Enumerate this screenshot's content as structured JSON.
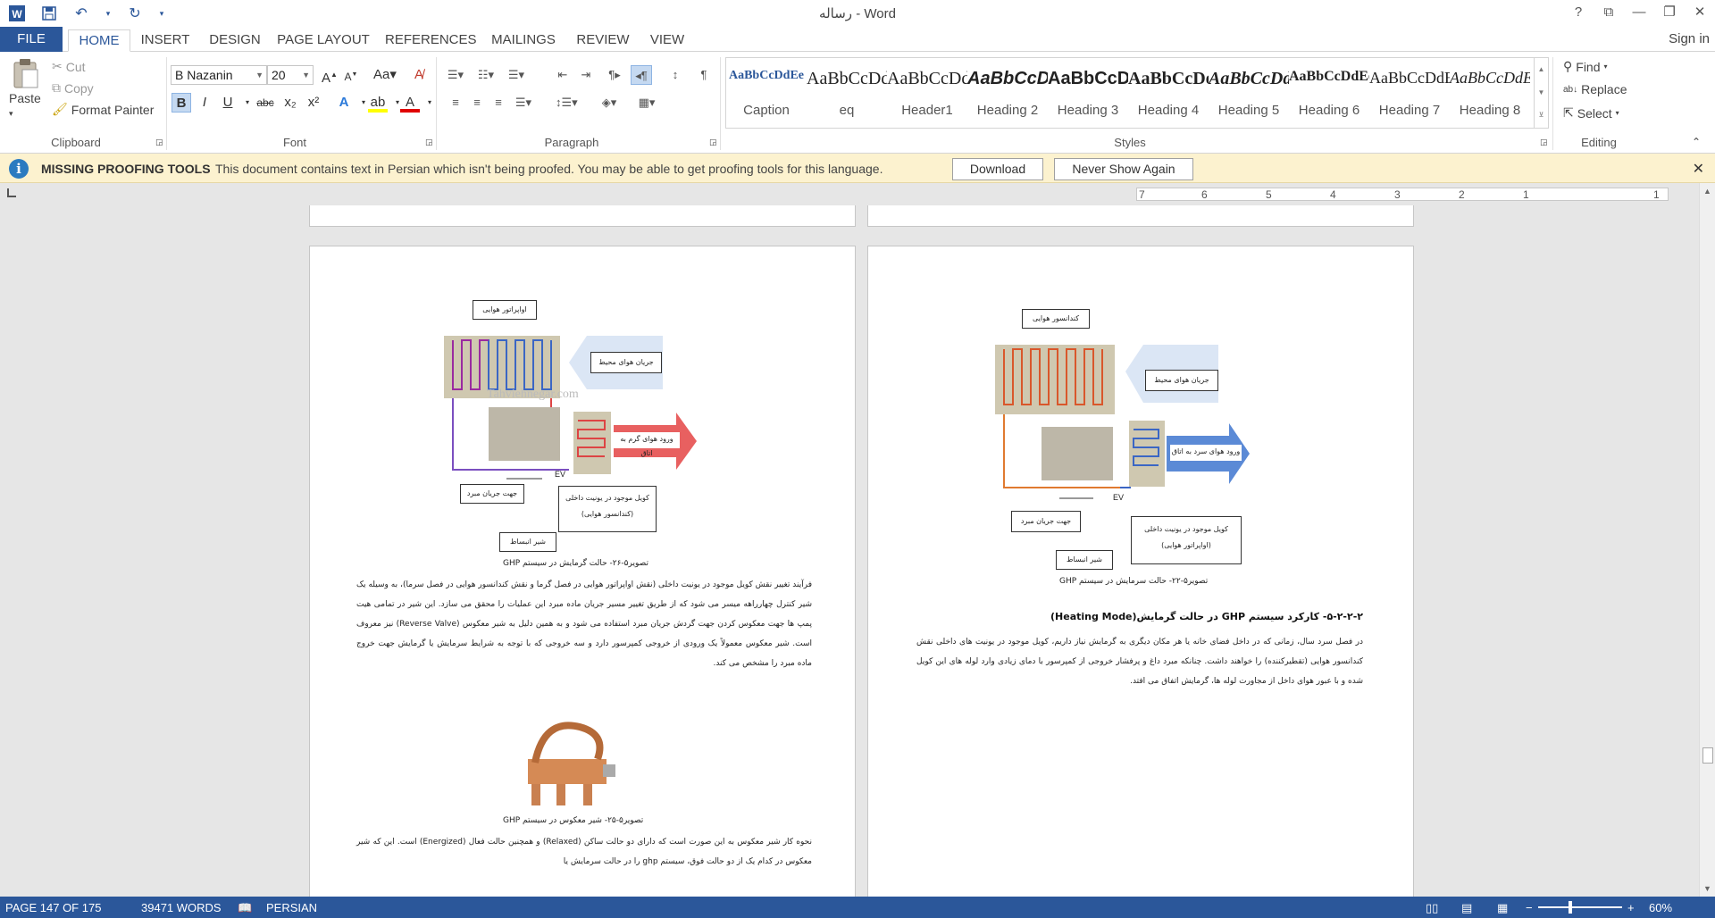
{
  "window": {
    "title": "رساله - Word"
  },
  "tabs": {
    "file": "FILE",
    "home": "HOME",
    "insert": "INSERT",
    "design": "DESIGN",
    "page_layout": "PAGE LAYOUT",
    "references": "REFERENCES",
    "mailings": "MAILINGS",
    "review": "REVIEW",
    "view": "VIEW",
    "sign_in": "Sign in"
  },
  "clipboard": {
    "paste": "Paste",
    "cut": "Cut",
    "copy": "Copy",
    "format_painter": "Format Painter",
    "label": "Clipboard"
  },
  "font": {
    "name": "B Nazanin",
    "size": "20",
    "label": "Font",
    "bold": "B",
    "italic": "I",
    "underline": "U",
    "strike": "abc",
    "subscript": "x₂",
    "superscript": "x²"
  },
  "paragraph": {
    "label": "Paragraph"
  },
  "styles": {
    "label": "Styles",
    "items": [
      {
        "sample": "AaBbCcDdEe",
        "name": "Caption"
      },
      {
        "sample": "AaBbCcDdEe",
        "name": "eq"
      },
      {
        "sample": "AaBbCcDdEe",
        "name": "Header1"
      },
      {
        "sample": "AaBbCcDdEe",
        "name": "Heading 2"
      },
      {
        "sample": "AaBbCcDdEe",
        "name": "Heading 3"
      },
      {
        "sample": "AaBbCcDdEe",
        "name": "Heading 4"
      },
      {
        "sample": "AaBbCcDdEe",
        "name": "Heading 5"
      },
      {
        "sample": "AaBbCcDdEe",
        "name": "Heading 6"
      },
      {
        "sample": "AaBbCcDdEe",
        "name": "Heading 7"
      },
      {
        "sample": "AaBbCcDdEe",
        "name": "Heading 8"
      }
    ]
  },
  "editing": {
    "find": "Find",
    "replace": "Replace",
    "select": "Select",
    "label": "Editing"
  },
  "message_bar": {
    "title": "MISSING PROOFING TOOLS",
    "text": "This document contains text in Persian which isn't being proofed. You may be able to get proofing tools for this language.",
    "download": "Download",
    "never_show": "Never Show Again"
  },
  "ruler": {
    "ticks": [
      "7",
      "6",
      "5",
      "4",
      "3",
      "2",
      "1",
      "1"
    ]
  },
  "left_page": {
    "fig1_labels": {
      "evaporator": "اواپراتور هوایی",
      "ambient": "جریان هوای محیط",
      "warm_air": "ورود هوای گرم به اتاق",
      "flow_dir": "جهت جریان مبرد",
      "expansion": "شیر انبساط",
      "indoor_coil": "کویل موجود در یونیت داخلی",
      "condenser_air": "(کندانسور هوایی)",
      "ev": "EV",
      "watermark": "Tahviehnegar.com"
    },
    "fig1_caption": "تصویر۵-۲۶- حالت گرمایش در سیستم GHP",
    "para1": "فرآیند تغییر نقش کویل موجود در یونیت داخلی (نقش اواپراتور هوایی در فصل گرما و نقش کندانسور هوایی در فصل سرما)، به وسیله یک شیر کنترل چهارراهه میسر می شود که از طریق تغییر مسیر جریان ماده مبرد این عملیات را محقق می سازد. این شیر در تمامی هیت پمپ ها جهت معکوس کردن جهت گردش جریان مبرد استفاده می شود و به همین دلیل به شیر معکوس (Reverse Valve) نیز معروف است. شیر معکوس معمولاً یک ورودی از خروجی کمپرسور دارد و سه خروجی که با توجه به شرایط سرمایش یا گرمایش جهت خروج ماده مبرد را مشخص می کند.",
    "fig2_caption": "تصویر۵-۲۵- شیر معکوس در سیستم GHP",
    "para2": "نحوه کار شیر معکوس به این صورت است که دارای دو حالت ساکن (Relaxed) و همچنین حالت فعال (Energized) است. این که شیر معکوس در کدام یک از دو حالت فوق، سیستم ghp را در حالت سرمایش یا"
  },
  "right_page": {
    "fig1_labels": {
      "condenser": "کندانسور هوایی",
      "ambient": "جریان هوای محیط",
      "cool_air": "ورود هوای سرد به اتاق",
      "flow_dir": "جهت جریان مبرد",
      "expansion": "شیر انبساط",
      "indoor_coil": "کویل موجود در یونیت داخلی",
      "evap_air": "(اواپراتور هوایی)",
      "ev": "EV"
    },
    "fig1_caption": "تصویر۵-۲۲- حالت سرمایش در سیستم GHP",
    "heading": "۵-۲-۲-۲- کارکرد سیستم GHP در حالت گرمایش(Heating Mode)",
    "para1": "در فصل سرد سال، زمانی که در داخل فضای خانه یا هر مکان دیگری به گرمایش نیاز داریم، کویل موجود در یونیت های داخلی نقش کندانسور هوایی (تقطیرکننده) را خواهند داشت. چنانکه مبرد داغ و پرفشار خروجی از کمپرسور با دمای زیادی وارد لوله های این کویل شده و با عبور هوای داخل از مجاورت لوله ها، گرمایش اتفاق می افتد."
  },
  "status": {
    "page": "PAGE 147 OF 175",
    "words": "39471 WORDS",
    "language": "PERSIAN",
    "zoom": "60%"
  },
  "colors": {
    "brand": "#2b579a",
    "message_bg": "#fcf2cf"
  }
}
